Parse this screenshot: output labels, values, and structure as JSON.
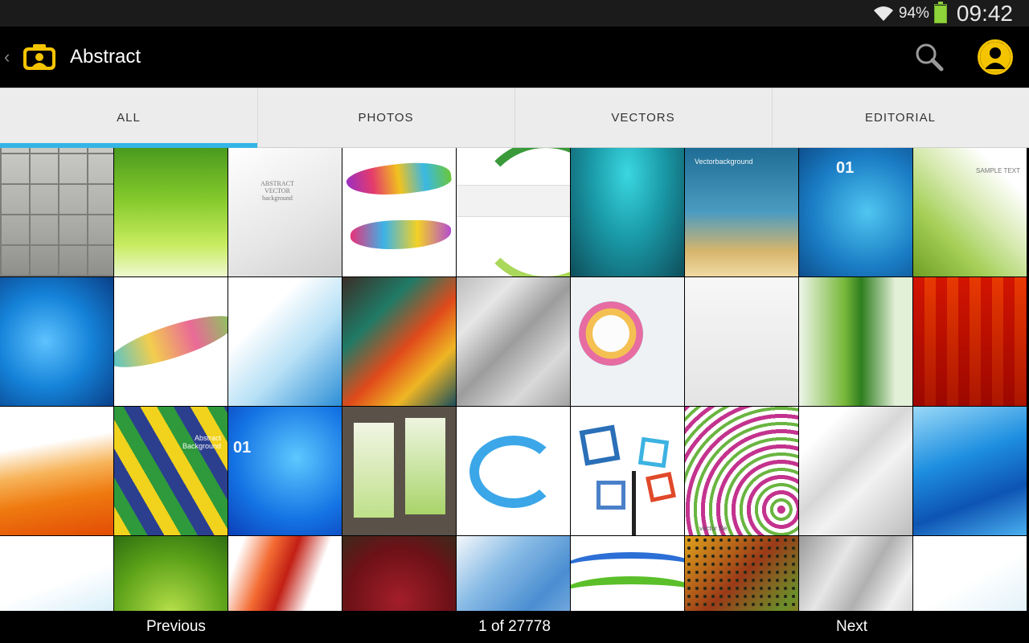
{
  "status": {
    "battery_percent": "94%",
    "battery_level": 0.94,
    "time": "09:42"
  },
  "app": {
    "title": "Abstract",
    "accent_color": "#f5c400",
    "tab_indicator_color": "#33b5e5"
  },
  "tabs": [
    {
      "label": "ALL",
      "active": true
    },
    {
      "label": "PHOTOS",
      "active": false
    },
    {
      "label": "VECTORS",
      "active": false
    },
    {
      "label": "EDITORIAL",
      "active": false
    }
  ],
  "thumb_captions": {
    "abstract_vector": "ABSTRACT VECTOR background",
    "vector_background": "Vectorbackground",
    "sample_text": "SAMPLE TEXT",
    "number_01": "01",
    "abstract_background": "Abstract Background",
    "vector_file": "vector file"
  },
  "footer": {
    "previous": "Previous",
    "page_indicator": "1 of 27778",
    "next": "Next"
  }
}
